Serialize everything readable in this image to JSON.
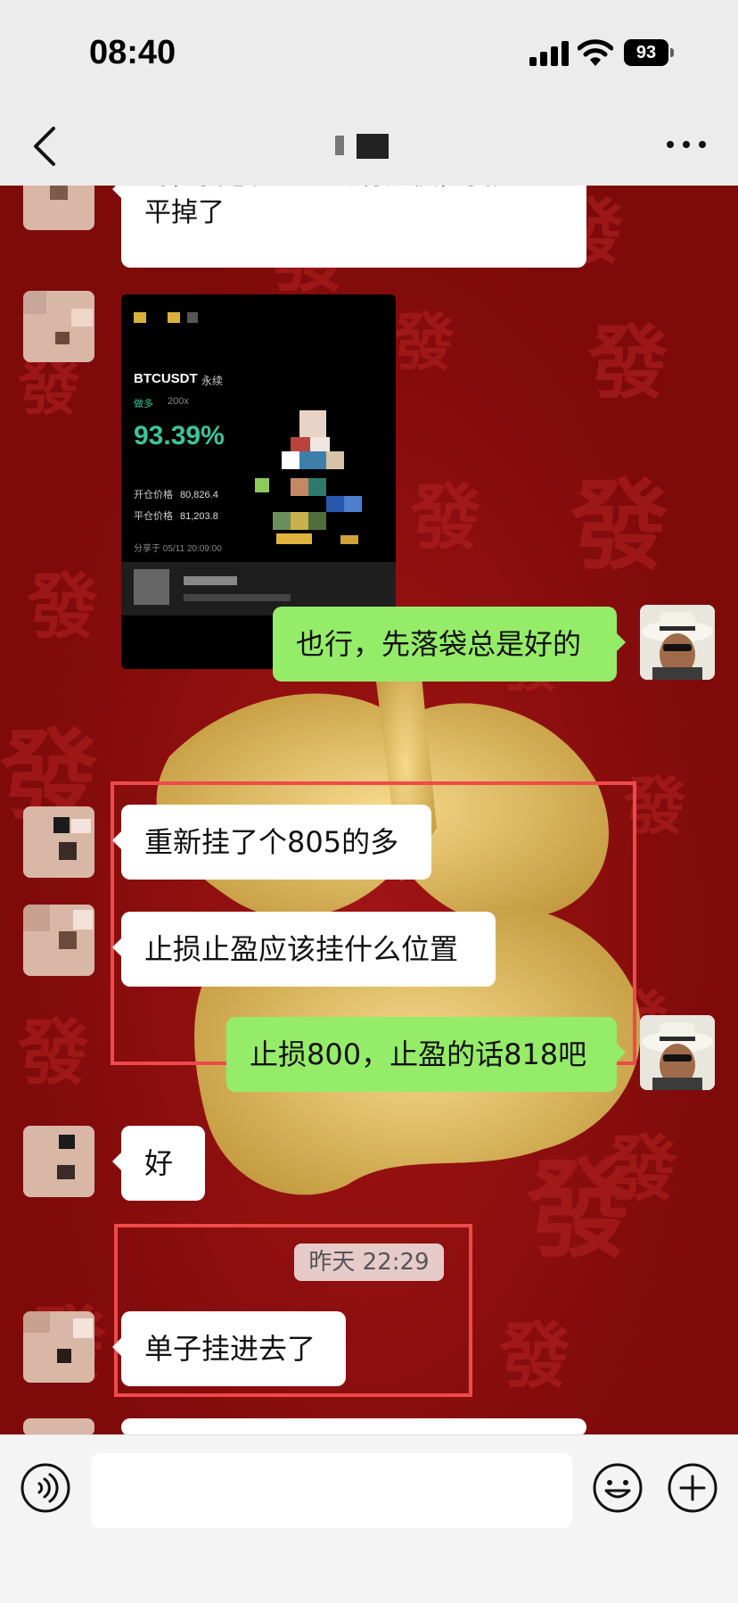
{
  "status_bar": {
    "time": "08:40",
    "battery": "93"
  },
  "nav": {
    "back_icon": "chevron-left-icon",
    "more_icon": "more-dots-icon"
  },
  "messages": {
    "top_partial": "哥，我感觉上去的有点慢，我先",
    "top_line2": "平掉了",
    "m1": "也行，先落袋总是好的",
    "m2": "重新挂了个805的多",
    "m3": "止损止盈应该挂什么位置",
    "m4": "止损800，止盈的话818吧",
    "m5": "好",
    "timestamp": "昨天 22:29",
    "m6": "单子挂进去了"
  },
  "trade_card": {
    "symbol": "BTCUSDT",
    "contract": "永续",
    "side": "做多",
    "leverage": "200x",
    "roi": "93.39%",
    "open_label": "开仓价格",
    "open_price": "80,826.4",
    "close_label": "平仓价格",
    "close_price": "81,203.8",
    "share_time": "分享于 05/11 20:09:00"
  },
  "input_bar": {
    "voice_icon": "voice-icon",
    "emoji_icon": "emoji-icon",
    "plus_icon": "plus-icon"
  },
  "colors": {
    "chat_bg": "#8e0c0c",
    "my_bubble": "#95ec69",
    "highlight_box": "#ef4a4a",
    "gain": "#3cc49a"
  }
}
